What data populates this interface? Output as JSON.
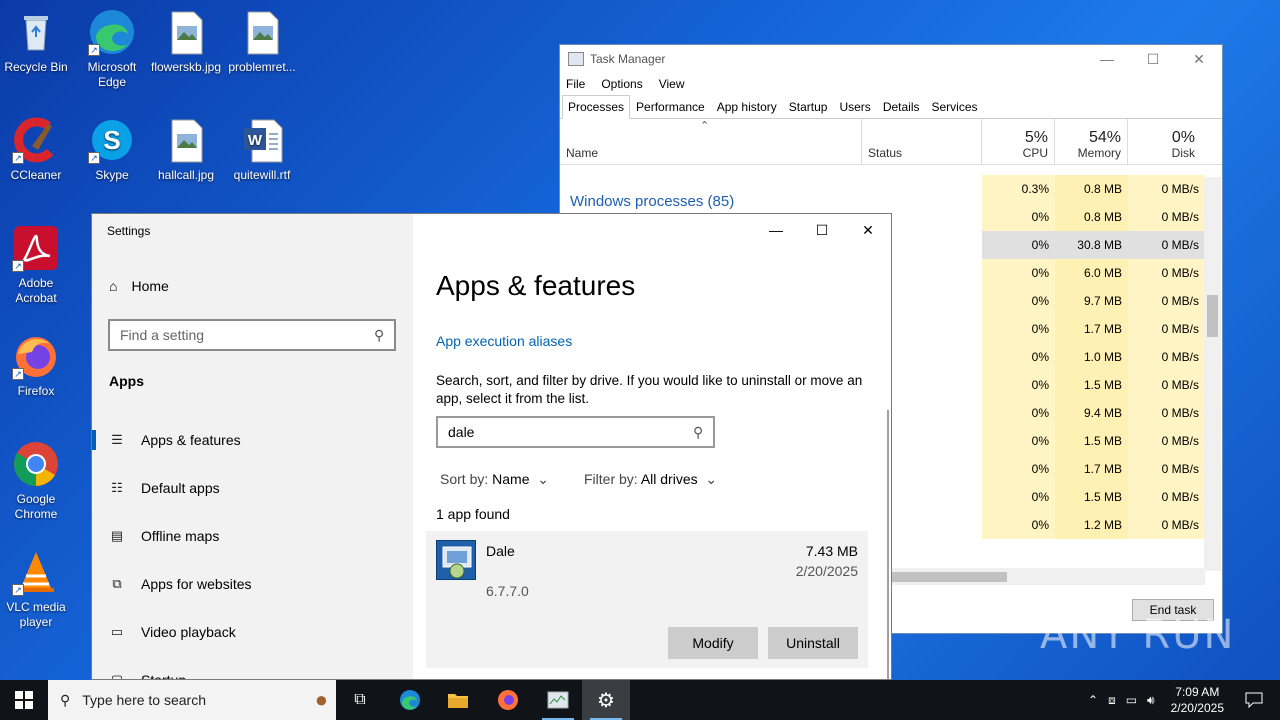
{
  "desktop": {
    "icons": [
      {
        "label": "Recycle Bin"
      },
      {
        "label": "Microsoft Edge"
      },
      {
        "label": "flowerskb.jpg"
      },
      {
        "label": "problemret..."
      },
      {
        "label": "CCleaner"
      },
      {
        "label": "Skype"
      },
      {
        "label": "hallcall.jpg"
      },
      {
        "label": "quitewill.rtf"
      },
      {
        "label": "Adobe Acrobat"
      },
      {
        "label": "Firefox"
      },
      {
        "label": "Google Chrome"
      },
      {
        "label": "VLC media player"
      }
    ]
  },
  "task_manager": {
    "title": "Task Manager",
    "menu": [
      "File",
      "Options",
      "View"
    ],
    "tabs": [
      "Processes",
      "Performance",
      "App history",
      "Startup",
      "Users",
      "Details",
      "Services"
    ],
    "columns": {
      "name": "Name",
      "status": "Status",
      "cpu_pct": "5%",
      "cpu": "CPU",
      "mem_pct": "54%",
      "mem": "Memory",
      "disk_pct": "0%",
      "disk": "Disk"
    },
    "group": "Windows processes (85)",
    "rows": [
      {
        "cpu": "0.3%",
        "mem": "0.8 MB",
        "disk": "0 MB/s"
      },
      {
        "cpu": "0%",
        "mem": "0.8 MB",
        "disk": "0 MB/s"
      },
      {
        "cpu": "0%",
        "mem": "30.8 MB",
        "disk": "0 MB/s"
      },
      {
        "cpu": "0%",
        "mem": "6.0 MB",
        "disk": "0 MB/s"
      },
      {
        "cpu": "0%",
        "mem": "9.7 MB",
        "disk": "0 MB/s"
      },
      {
        "cpu": "0%",
        "mem": "1.7 MB",
        "disk": "0 MB/s"
      },
      {
        "cpu": "0%",
        "mem": "1.0 MB",
        "disk": "0 MB/s"
      },
      {
        "cpu": "0%",
        "mem": "1.5 MB",
        "disk": "0 MB/s"
      },
      {
        "cpu": "0%",
        "mem": "9.4 MB",
        "disk": "0 MB/s"
      },
      {
        "cpu": "0%",
        "mem": "1.5 MB",
        "disk": "0 MB/s"
      },
      {
        "cpu": "0%",
        "mem": "1.7 MB",
        "disk": "0 MB/s"
      },
      {
        "cpu": "0%",
        "mem": "1.5 MB",
        "disk": "0 MB/s"
      },
      {
        "cpu": "0%",
        "mem": "1.2 MB",
        "disk": "0 MB/s"
      }
    ],
    "end_task": "End task"
  },
  "settings": {
    "window_title": "Settings",
    "home": "Home",
    "search_placeholder": "Find a setting",
    "section": "Apps",
    "nav": [
      "Apps & features",
      "Default apps",
      "Offline maps",
      "Apps for websites",
      "Video playback",
      "Startup"
    ],
    "page_title": "Apps & features",
    "alias_link": "App execution aliases",
    "description": "Search, sort, and filter by drive. If you would like to uninstall or move an app, select it from the list.",
    "filter_value": "dale",
    "sort_label": "Sort by:",
    "sort_value": "Name",
    "filter_label": "Filter by:",
    "filter_drive": "All drives",
    "found": "1 app found",
    "app": {
      "name": "Dale",
      "size": "7.43 MB",
      "date": "2/20/2025",
      "version": "6.7.7.0"
    },
    "modify": "Modify",
    "uninstall": "Uninstall"
  },
  "taskbar": {
    "search_placeholder": "Type here to search",
    "time": "7:09 AM",
    "date": "2/20/2025"
  },
  "watermark": "ANY RUN"
}
